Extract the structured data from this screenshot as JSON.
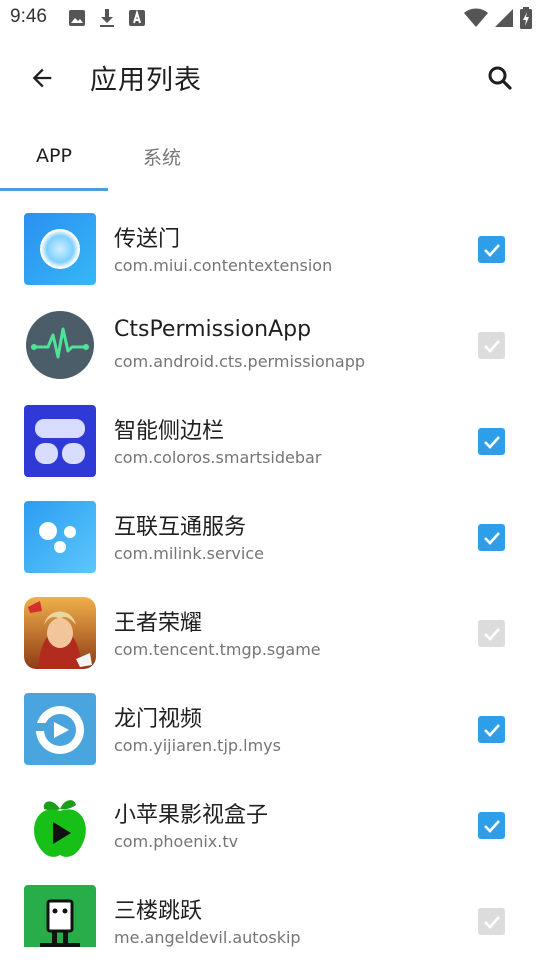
{
  "status_bar": {
    "time": "9:46",
    "left_icons": [
      "image-icon",
      "download-icon",
      "a-badge-icon"
    ],
    "right_icons": [
      "wifi-icon",
      "signal-icon",
      "battery-icon"
    ]
  },
  "appbar": {
    "title": "应用列表",
    "back_icon": "arrow-back-icon",
    "search_icon": "search-icon"
  },
  "tabs": [
    {
      "label": "APP",
      "selected": true
    },
    {
      "label": "系统",
      "selected": false
    }
  ],
  "colors": {
    "accent": "#4f9cd9",
    "checkbox_checked": "#2f9ee8",
    "checkbox_disabled": "#dcdcdc"
  },
  "apps": [
    {
      "name": "传送门",
      "package": "com.miui.contentextension",
      "checked": true,
      "enabled": true,
      "icon": "transport-door-icon"
    },
    {
      "name": "CtsPermissionApp",
      "package": "com.android.cts.permissionapp",
      "checked": true,
      "enabled": false,
      "icon": "pulse-icon"
    },
    {
      "name": "智能侧边栏",
      "package": "com.coloros.smartsidebar",
      "checked": true,
      "enabled": true,
      "icon": "sidebar-icon"
    },
    {
      "name": "互联互通服务",
      "package": "com.milink.service",
      "checked": true,
      "enabled": true,
      "icon": "dots-icon"
    },
    {
      "name": "王者荣耀",
      "package": "com.tencent.tmgp.sgame",
      "checked": true,
      "enabled": false,
      "icon": "game-hero-icon"
    },
    {
      "name": "龙门视频",
      "package": "com.yijiaren.tjp.lmys",
      "checked": true,
      "enabled": true,
      "icon": "video-play-icon"
    },
    {
      "name": "小苹果影视盒子",
      "package": "com.phoenix.tv",
      "checked": true,
      "enabled": true,
      "icon": "green-apple-icon"
    },
    {
      "name": "三楼跳跃",
      "package": "me.angeldevil.autoskip",
      "checked": true,
      "enabled": false,
      "icon": "robot-icon"
    }
  ]
}
